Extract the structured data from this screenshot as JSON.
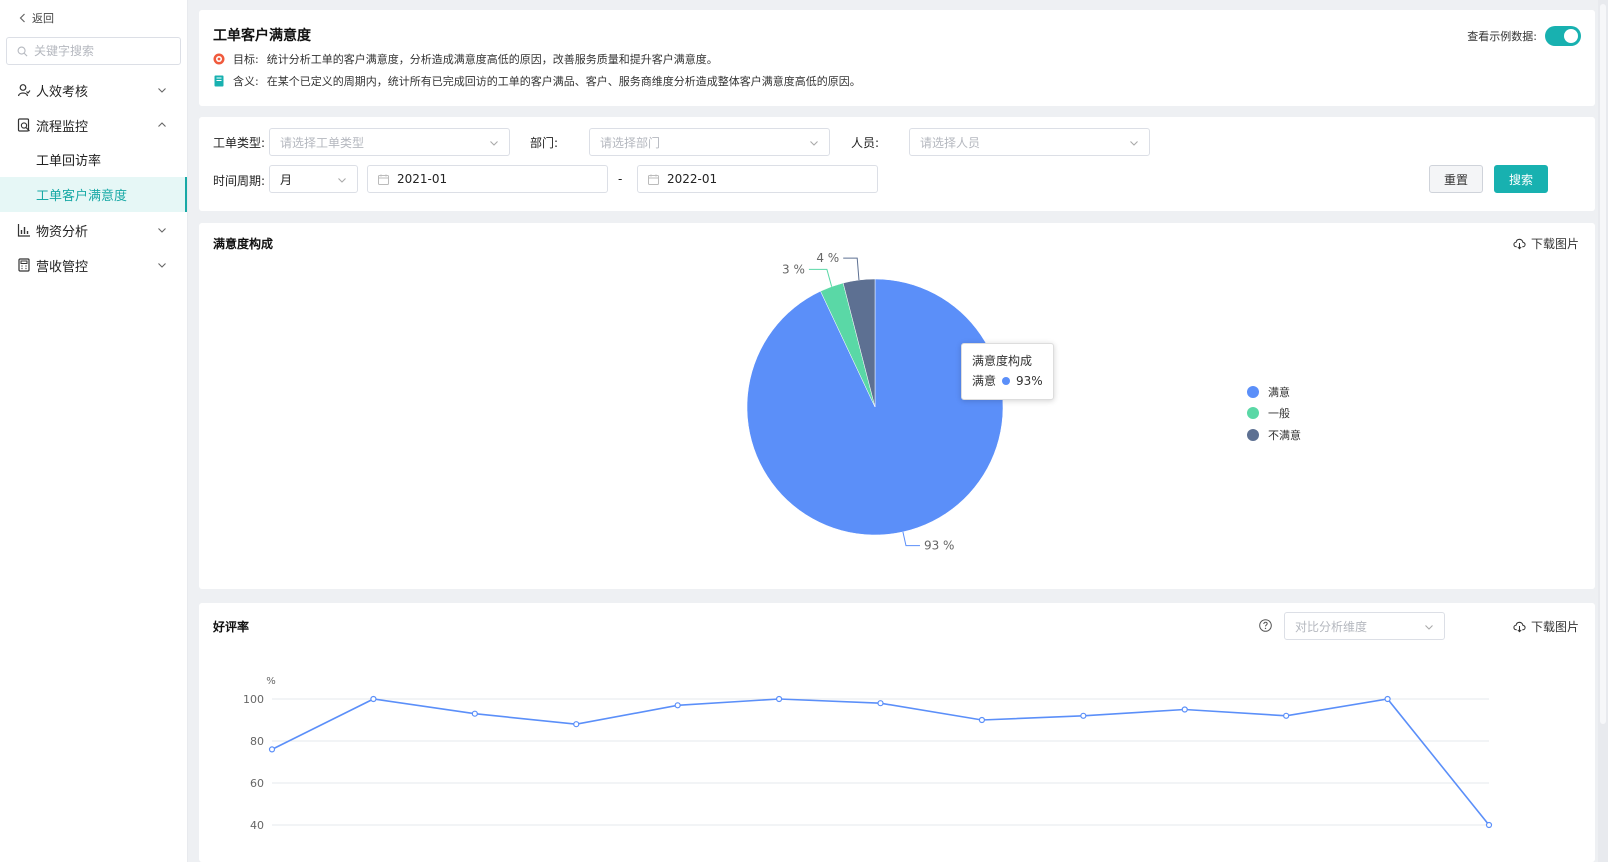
{
  "sidebar": {
    "back_label": "返回",
    "search_placeholder": "关键字搜索",
    "items": [
      {
        "label": "人效考核",
        "icon": "person-icon",
        "expanded": false
      },
      {
        "label": "流程监控",
        "icon": "monitor-icon",
        "expanded": true
      },
      {
        "label": "物资分析",
        "icon": "bar-chart-icon",
        "expanded": false
      },
      {
        "label": "营收管控",
        "icon": "calculator-icon",
        "expanded": false
      }
    ],
    "sub_items": [
      {
        "label": "工单回访率",
        "active": false
      },
      {
        "label": "工单客户满意度",
        "active": true
      }
    ]
  },
  "header": {
    "title": "工单客户满意度",
    "goal_label": "目标:",
    "goal_text": "统计分析工单的客户满意度，分析造成满意度高低的原因，改善服务质量和提升客户满意度。",
    "meaning_label": "含义:",
    "meaning_text": "在某个已定义的周期内，统计所有已完成回访的工单的客户满品、客户、服务商维度分析造成整体客户满意度高低的原因。",
    "sample_toggle_label": "查看示例数据:",
    "sample_toggle_on": true
  },
  "filters": {
    "type_label": "工单类型:",
    "type_placeholder": "请选择工单类型",
    "dept_label": "部门:",
    "dept_placeholder": "请选择部门",
    "person_label": "人员:",
    "person_placeholder": "请选择人员",
    "period_label": "时间周期:",
    "period_value": "月",
    "start_date": "2021-01",
    "date_separator": "-",
    "end_date": "2022-01",
    "reset_label": "重置",
    "search_label": "搜索"
  },
  "pie_section": {
    "title": "满意度构成",
    "download_label": "下载图片",
    "tooltip": {
      "title": "满意度构成",
      "series": "满意",
      "value": "93%"
    }
  },
  "line_section": {
    "title": "好评率",
    "compare_placeholder": "对比分析维度",
    "download_label": "下载图片"
  },
  "colors": {
    "accent": "#18b1b0",
    "satisfied": "#5b8ff9",
    "normal": "#5ad8a6",
    "unsatisfied": "#5d7092"
  },
  "chart_data": [
    {
      "type": "pie",
      "title": "满意度构成",
      "categories": [
        "满意",
        "一般",
        "不满意"
      ],
      "values": [
        93,
        3,
        4
      ],
      "labels": [
        "93 %",
        "3 %",
        "4 %"
      ],
      "legend": "right"
    },
    {
      "type": "line",
      "title": "好评率",
      "ylabel": "%",
      "ylim": [
        40,
        100
      ],
      "yticks": [
        40,
        60,
        80,
        100
      ],
      "series": [
        {
          "values": [
            76,
            100,
            93,
            88,
            97,
            100,
            98,
            90,
            92,
            95,
            92,
            100,
            40
          ]
        }
      ],
      "grid": true
    }
  ]
}
